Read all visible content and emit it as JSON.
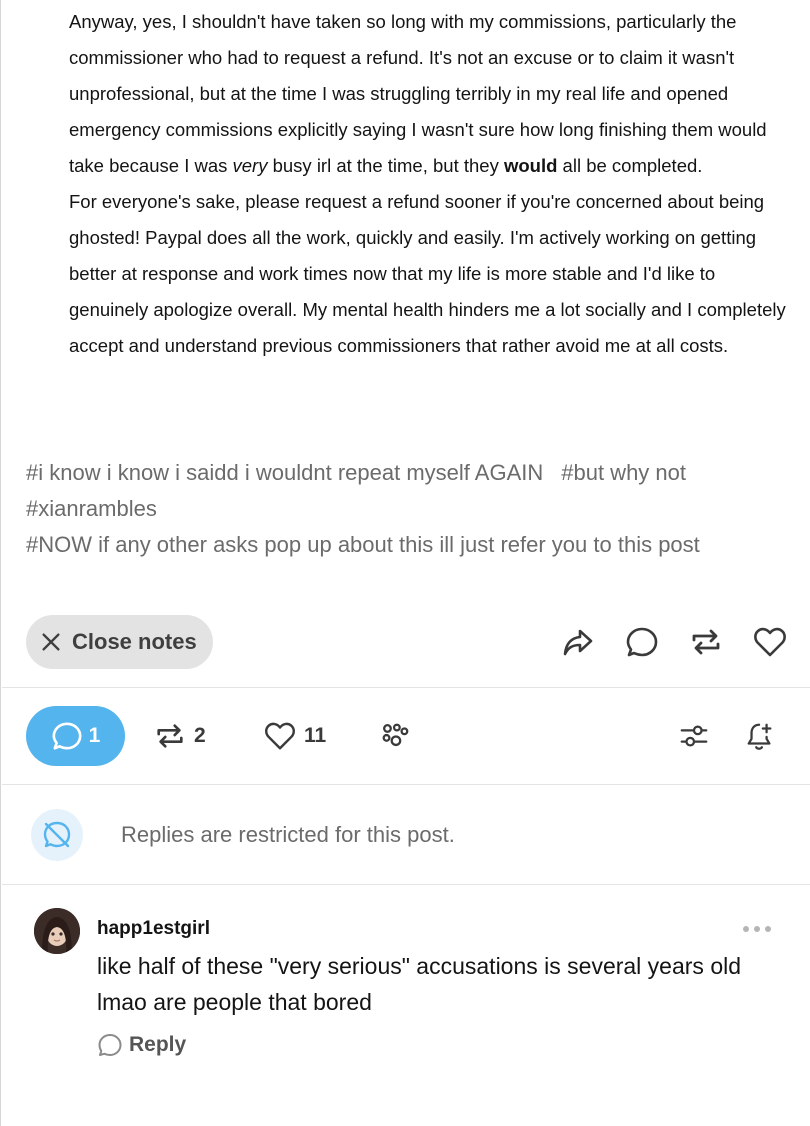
{
  "post": {
    "para1_a": "Anyway, yes, I shouldn't have taken so long with my commissions, particularly the commissioner who had to request a refund. It's not an excuse or to claim it wasn't unprofessional, but at the time I was struggling terribly in my real life and opened emergency commissions explicitly saying I wasn't sure how long finishing them would take because I was ",
    "para1_em": "very",
    "para1_b": " busy irl at the time, but they ",
    "para1_bold": "would",
    "para1_c": " all be completed.",
    "para2": "For everyone's sake, please request a refund sooner if you're concerned about being ghosted! Paypal does all the work, quickly and easily. I'm actively working on getting better at response and work times now that my life is more stable and I'd like to genuinely apologize overall. My mental health hinders me a lot socially and I completely accept and understand previous commissioners  that rather avoid me at all costs."
  },
  "tags": [
    "#i know i know i saidd i wouldnt repeat myself AGAIN",
    "#but why not",
    "#xianrambles",
    "#NOW if any other asks pop up about this ill just refer you to this post"
  ],
  "close_notes_label": "Close notes",
  "post_action_icons": [
    "share-icon",
    "reply-icon",
    "reblog-icon",
    "like-icon"
  ],
  "notes": {
    "replies_count": "1",
    "reblogs_count": "2",
    "likes_count": "11"
  },
  "restricted_text": "Replies are restricted for this post.",
  "reply": {
    "username": "happ1estgirl",
    "text": "like half of these \"very serious\" accusations is several years old lmao are people that bored",
    "reply_label": "Reply"
  },
  "colors": {
    "accent": "#53b4ee",
    "tag_text": "#6b6b6b",
    "pill_bg": "#e3e3e3"
  }
}
